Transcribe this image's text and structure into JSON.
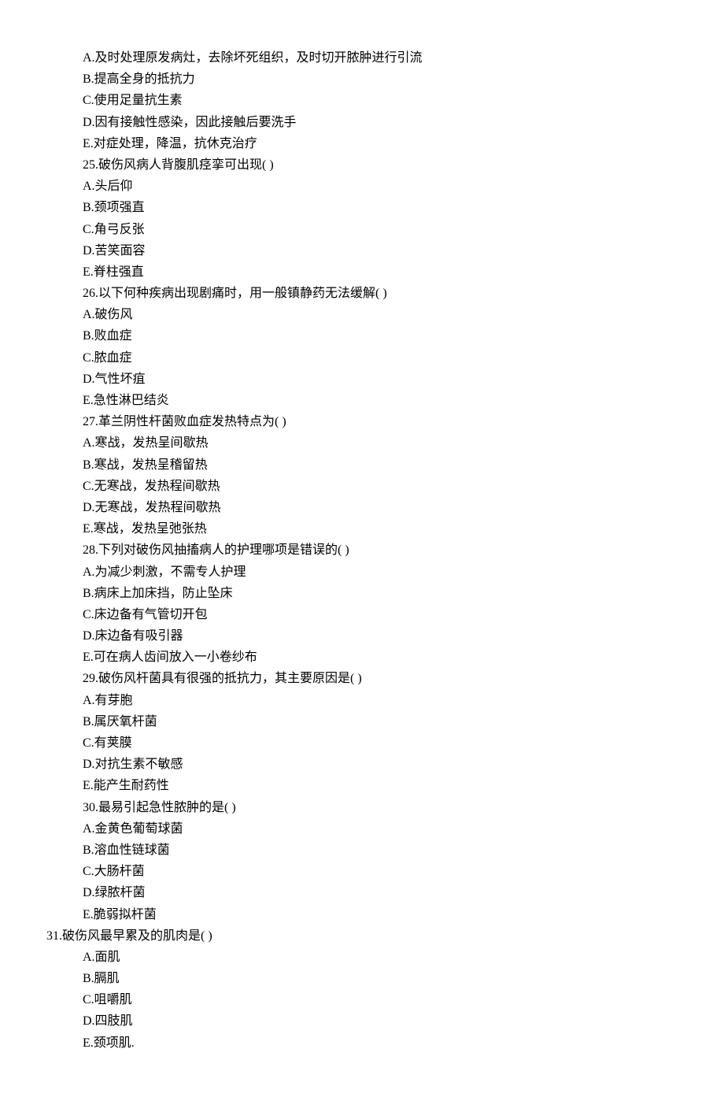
{
  "lines": [
    {
      "indent": 2,
      "text": "A.及时处理原发病灶，去除坏死组织，及时切开脓肿进行引流"
    },
    {
      "indent": 2,
      "text": "B.提高全身的抵抗力"
    },
    {
      "indent": 2,
      "text": "C.使用足量抗生素"
    },
    {
      "indent": 2,
      "text": "D.因有接触性感染，因此接触后要洗手"
    },
    {
      "indent": 2,
      "text": "E.对症处理，降温，抗休克治疗"
    },
    {
      "indent": 2,
      "text": "25.破伤风病人背腹肌痉挛可出现( )"
    },
    {
      "indent": 2,
      "text": "A.头后仰"
    },
    {
      "indent": 2,
      "text": "B.颈项强直"
    },
    {
      "indent": 2,
      "text": "C.角弓反张"
    },
    {
      "indent": 2,
      "text": "D.苦笑面容"
    },
    {
      "indent": 2,
      "text": "E.脊柱强直"
    },
    {
      "indent": 2,
      "text": "26.以下何种疾病出现剧痛时，用一般镇静药无法缓解( )"
    },
    {
      "indent": 2,
      "text": "A.破伤风"
    },
    {
      "indent": 2,
      "text": "B.败血症"
    },
    {
      "indent": 2,
      "text": "C.脓血症"
    },
    {
      "indent": 2,
      "text": "D.气性坏疽"
    },
    {
      "indent": 2,
      "text": "E.急性淋巴结炎"
    },
    {
      "indent": 2,
      "text": "27.革兰阴性杆菌败血症发热特点为( )"
    },
    {
      "indent": 2,
      "text": "A.寒战，发热呈间歇热"
    },
    {
      "indent": 2,
      "text": "B.寒战，发热呈稽留热"
    },
    {
      "indent": 2,
      "text": "C.无寒战，发热程间歇热"
    },
    {
      "indent": 2,
      "text": "D.无寒战，发热程间歇热"
    },
    {
      "indent": 2,
      "text": "E.寒战，发热呈弛张热"
    },
    {
      "indent": 2,
      "text": "28.下列对破伤风抽搐病人的护理哪项是错误的( )"
    },
    {
      "indent": 2,
      "text": "A.为减少刺激，不需专人护理"
    },
    {
      "indent": 2,
      "text": "B.病床上加床挡，防止坠床"
    },
    {
      "indent": 2,
      "text": "C.床边备有气管切开包"
    },
    {
      "indent": 2,
      "text": "D.床边备有吸引器"
    },
    {
      "indent": 2,
      "text": "E.可在病人齿间放入一小卷纱布"
    },
    {
      "indent": 2,
      "text": "29.破伤风杆菌具有很强的抵抗力，其主要原因是( )"
    },
    {
      "indent": 2,
      "text": "A.有芽胞"
    },
    {
      "indent": 2,
      "text": "B.属厌氧杆菌"
    },
    {
      "indent": 2,
      "text": "C.有荚膜"
    },
    {
      "indent": 2,
      "text": "D.对抗生素不敏感"
    },
    {
      "indent": 2,
      "text": "E.能产生耐药性"
    },
    {
      "indent": 2,
      "text": "30.最易引起急性脓肿的是( )"
    },
    {
      "indent": 2,
      "text": "A.金黄色葡萄球菌"
    },
    {
      "indent": 2,
      "text": "B.溶血性链球菌"
    },
    {
      "indent": 2,
      "text": "C.大肠杆菌"
    },
    {
      "indent": 2,
      "text": "D.绿脓杆菌"
    },
    {
      "indent": 2,
      "text": "E.脆弱拟杆菌"
    },
    {
      "indent": 1,
      "text": "31.破伤风最早累及的肌肉是( )"
    },
    {
      "indent": 2,
      "text": "A.面肌"
    },
    {
      "indent": 2,
      "text": "B.膈肌"
    },
    {
      "indent": 2,
      "text": "C.咀嚼肌"
    },
    {
      "indent": 2,
      "text": "D.四肢肌"
    },
    {
      "indent": 2,
      "text": "E.颈项肌."
    }
  ]
}
